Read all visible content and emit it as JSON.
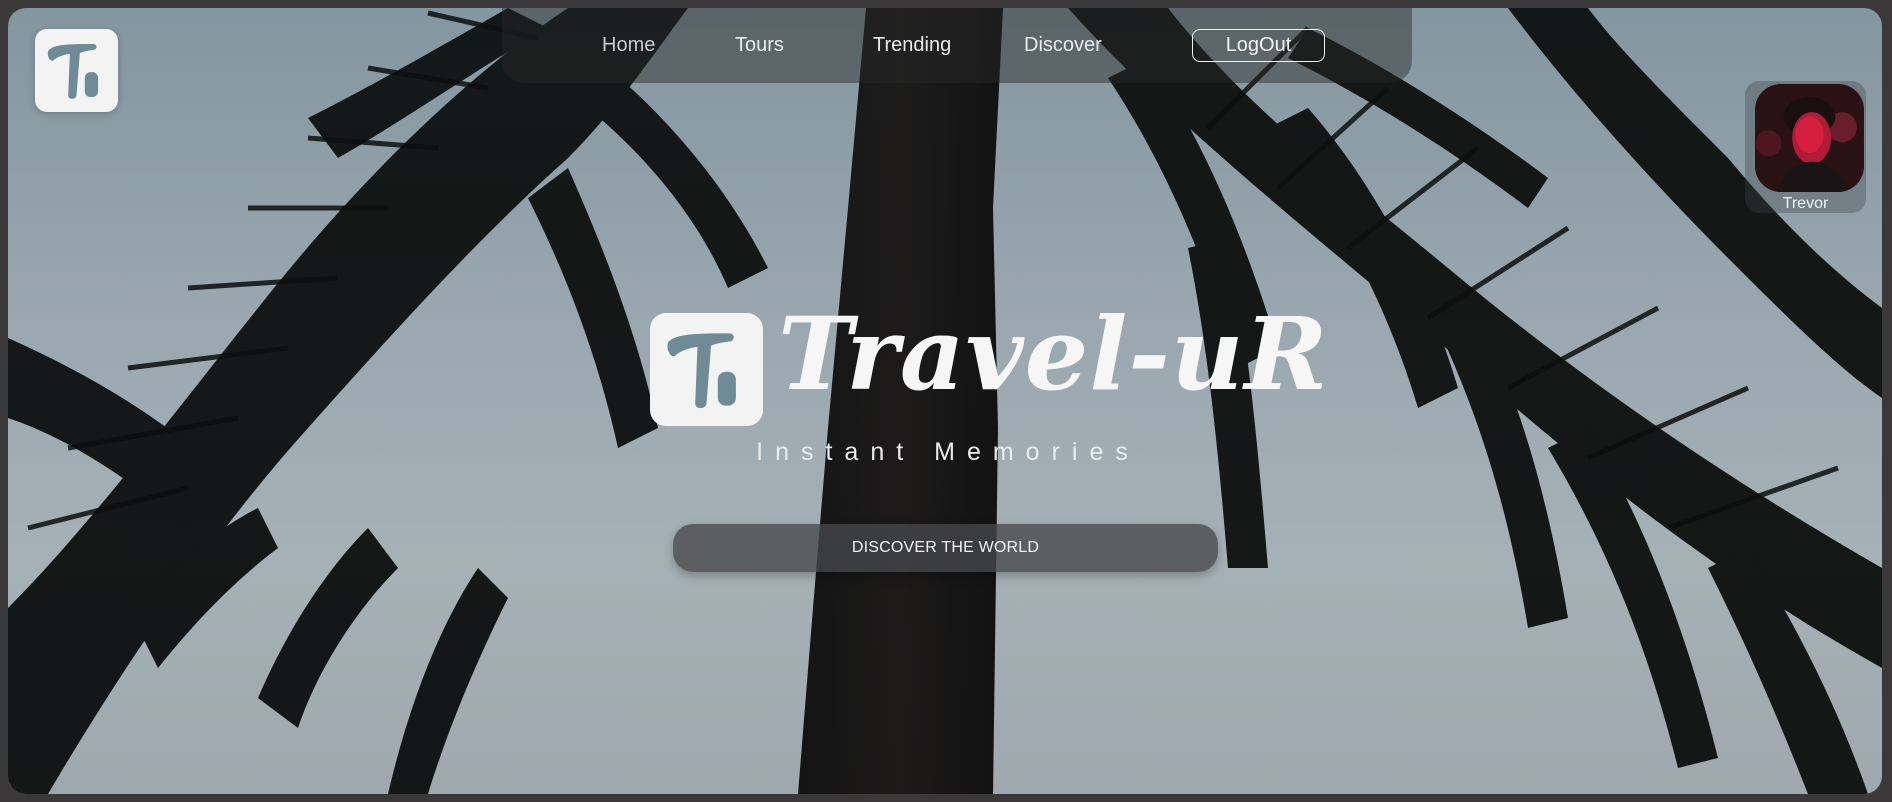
{
  "nav": {
    "items": [
      {
        "label": "Home"
      },
      {
        "label": "Tours"
      },
      {
        "label": "Trending"
      },
      {
        "label": "Discover"
      }
    ],
    "logout_label": "LogOut"
  },
  "profile": {
    "name": "Trevor"
  },
  "hero": {
    "title": "Travel-uR",
    "subtitle": "Instant Memories",
    "cta_label": "DISCOVER THE WORLD"
  },
  "icons": {
    "brand_logo": "tr-logo-icon",
    "avatar": "user-avatar"
  },
  "colors": {
    "nav_bg": "#282828",
    "logo_bg": "#f3f3f3",
    "logo_mark": "#6f8c96",
    "cta_bg": "#46484a",
    "text_light": "#f6f6f6"
  }
}
